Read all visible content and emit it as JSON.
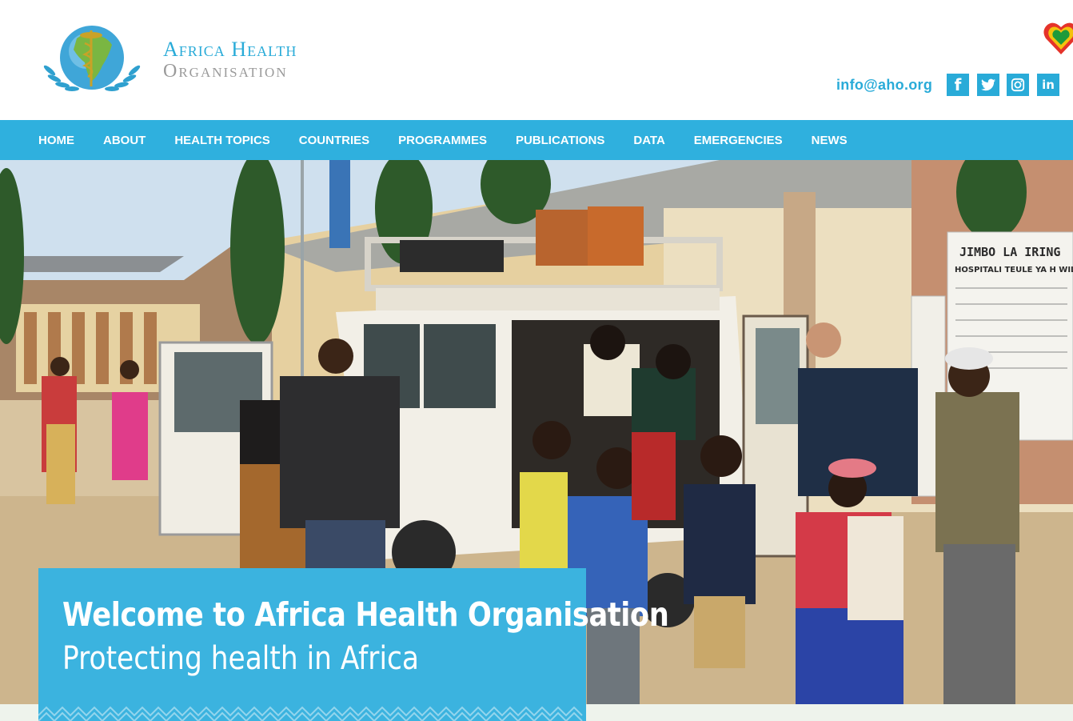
{
  "brand": {
    "name_line1": "Africa Health",
    "name_line2": "Organisation"
  },
  "contact": {
    "email": "info@aho.org"
  },
  "social": [
    {
      "name": "facebook-icon",
      "glyph": "f"
    },
    {
      "name": "twitter-icon",
      "glyph": "🐦"
    },
    {
      "name": "instagram-icon",
      "glyph": "◎"
    },
    {
      "name": "linkedin-icon",
      "glyph": "in"
    }
  ],
  "nav": {
    "items": [
      {
        "label": "HOME"
      },
      {
        "label": "ABOUT"
      },
      {
        "label": "HEALTH TOPICS"
      },
      {
        "label": "COUNTRIES"
      },
      {
        "label": "PROGRAMMES"
      },
      {
        "label": "PUBLICATIONS"
      },
      {
        "label": "DATA"
      },
      {
        "label": "EMERGENCIES"
      },
      {
        "label": "NEWS"
      }
    ]
  },
  "hero": {
    "title": "Welcome to Africa Health Organisation",
    "subtitle": "Protecting health in Africa",
    "sign_text": "JIMBO LA IRING",
    "sign_sub": "HOSPITALI TEULE YA H WILAY"
  },
  "colors": {
    "accent": "#2fb0de",
    "welcome_bg": "#3bb3df",
    "logo_blue": "#29abd8",
    "logo_grey": "#9a9a9a"
  }
}
